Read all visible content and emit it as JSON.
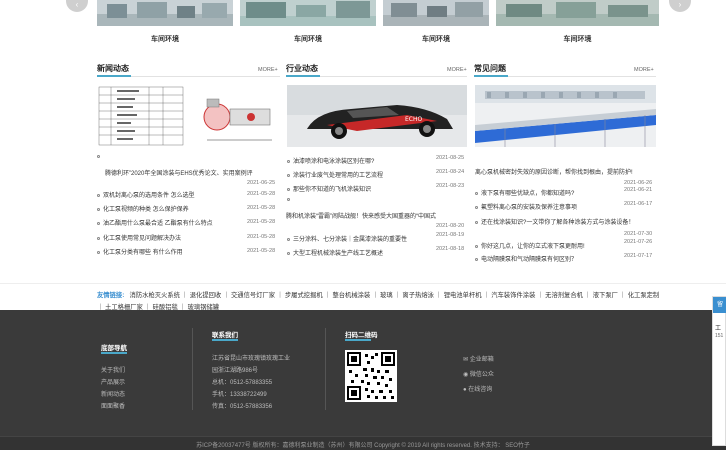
{
  "gallery": {
    "captions": [
      "车间环境",
      "车间环境",
      "车间环境",
      "车间环境"
    ],
    "prev_arrow": "‹",
    "next_arrow": "›"
  },
  "sections": {
    "news": {
      "title": "新闻动态",
      "more": "MORE+",
      "items": [
        {
          "title": "腾德利环”2020年全国涂装与EHS优秀论文、实用案例评",
          "date": "2021-06-25"
        },
        {
          "title": "双机封离心泵的选用条件 怎么选型",
          "date": "2021-05-28"
        },
        {
          "title": "化工泵视频的种类 怎么保护保养",
          "date": "2021-05-28"
        },
        {
          "title": "油乙酯用什么泵最合适 乙酯泵有什么特点",
          "date": "2021-05-28"
        },
        {
          "title": "化工泵使用常见问题解决办法",
          "date": "2021-05-28"
        },
        {
          "title": "化工泵分类有哪些 有什么作用",
          "date": "2021-05-28"
        }
      ]
    },
    "industry": {
      "title": "行业动态",
      "more": "MORE+",
      "items": [
        {
          "title": "油漆喷涂和电泳涂装区别在哪?",
          "date": "2021-08-25"
        },
        {
          "title": "涂装行业废气处理常用的工艺流程",
          "date": "2021-08-24"
        },
        {
          "title": "那些你不知道的飞机涂装知识",
          "date": "2021-08-23"
        },
        {
          "title": "腾和机涂装“雷霸”闹陆战舰！快来感受大国重器的“中国式",
          "date": "2021-08-20"
        },
        {
          "title": "三分涂料、七分涂装｜金属漆涂装的重要性",
          "date": "2021-08-19"
        },
        {
          "title": "大型工程机械涂装生产线工艺概述",
          "date": "2021-08-18"
        }
      ]
    },
    "faq": {
      "title": "常见问题",
      "more": "MORE+",
      "items": [
        {
          "title": "离心泵机械密封失效的原因诊断，帮你找到根由，提前防护!",
          "date": "2021-06-26"
        },
        {
          "title": "液下泵有哪些优缺点，你都知道吗?",
          "date": "2021-06-21"
        },
        {
          "title": "氟塑料离心泵的安装及保养注意事项",
          "date": "2021-06-17"
        },
        {
          "title": "还在找涂装知识?一文带你了解各种涂装方式与涂装设备！",
          "date": "2021-07-30"
        },
        {
          "title": "你好这几点，让你的立式液下泵更耐用!",
          "date": "2021-07-26"
        },
        {
          "title": "电动隔膜泵和气动隔膜泵有何区别？",
          "date": "2021-07-17"
        }
      ]
    }
  },
  "links": {
    "label": "友情链接:",
    "items": [
      "消防水枪灭火系统",
      "退化提回收",
      "交通信号灯厂家",
      "步履式挖掘机",
      "整台机械涂装",
      "玻璃",
      "离子热熔泳",
      "锂电池单杆机",
      "汽车装饰件涂装",
      "无溶剂复合机",
      "液下泵厂",
      "化工泵定制",
      "土工格栅厂家",
      "硅酸铝毯",
      "玻璃钢储罐"
    ]
  },
  "footer": {
    "nav_title": "底部导航",
    "nav_items": [
      "关于我们",
      "产品展示",
      "新闻动态",
      "面面聚香"
    ],
    "contact_title": "联系我们",
    "contact_lines": [
      "江苏省昆山市玫瑰镇玫瑰工业",
      "园浙江湖路986号",
      "总机：0512-57883355",
      "手机：13338722499",
      "传真：0512-57883356"
    ],
    "qr_title": "扫码二维码",
    "social": [
      "企业邮箱",
      "微信公众",
      "在线咨询"
    ],
    "copyright": "苏ICP备20037477号   版权所有：嘉德利泵业制造（苏州）有限公司 Copyright © 2019 All rights reserved. 技术支持：  SEO竹子"
  },
  "side_widget": {
    "lines": [
      "留",
      "工",
      "151"
    ]
  },
  "colors": {
    "accent": "#4aa8c9",
    "footer_bg": "#3a3a3a",
    "link_label": "#3a8fd0"
  }
}
